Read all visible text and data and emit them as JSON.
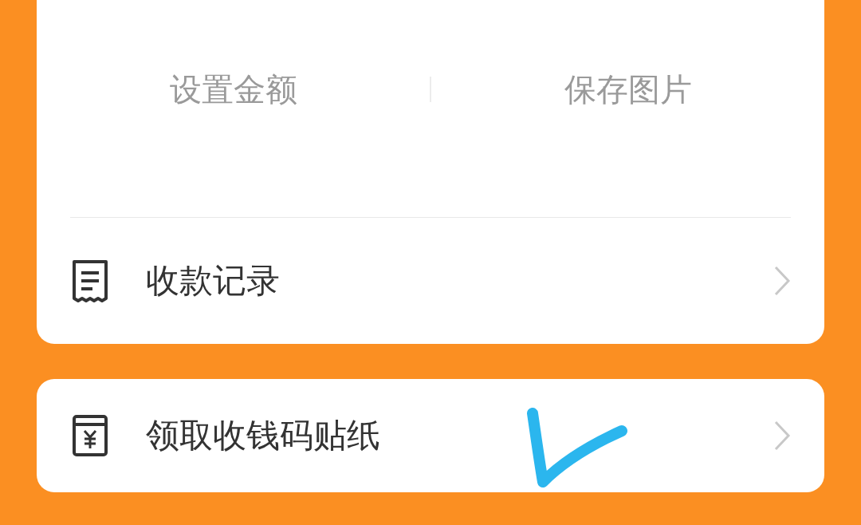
{
  "actions": [
    "设置金额",
    "保存图片"
  ],
  "rows": [
    {
      "label": "收款记录"
    }
  ],
  "card2_rows": [
    {
      "label": "领取收钱码贴纸"
    }
  ]
}
